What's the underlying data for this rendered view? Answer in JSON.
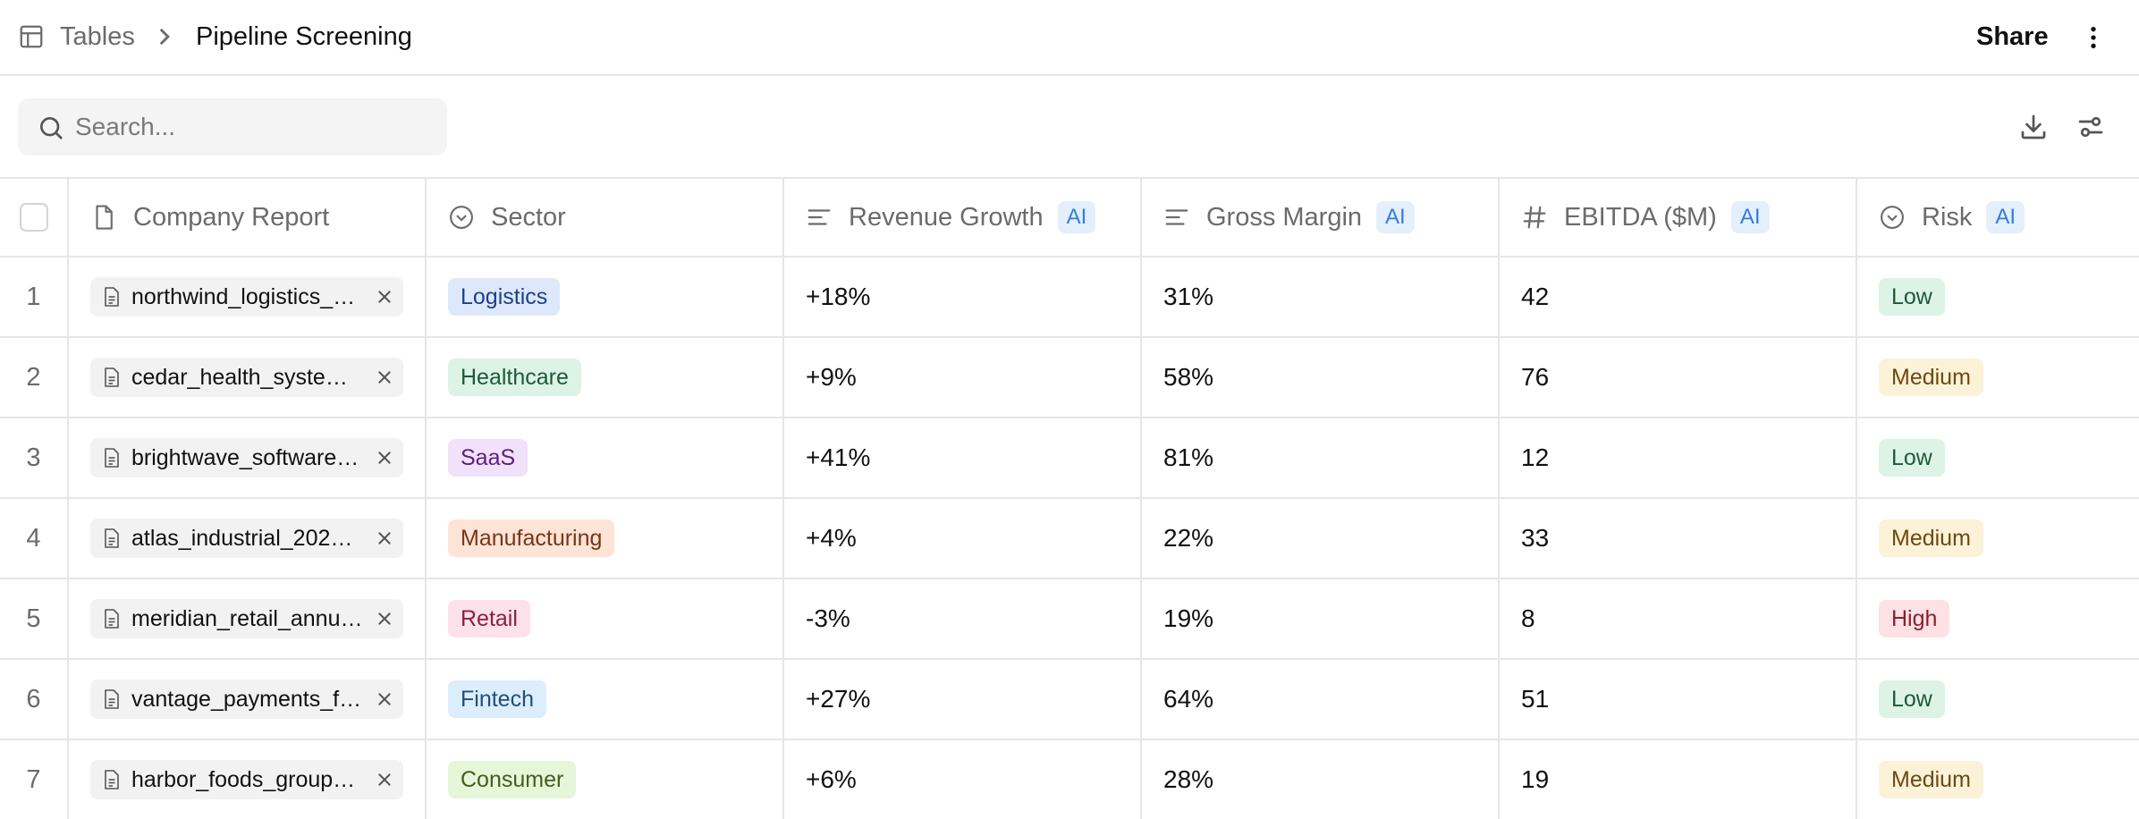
{
  "breadcrumb": {
    "root": "Tables",
    "current": "Pipeline Screening"
  },
  "header_actions": {
    "share_label": "Share"
  },
  "search": {
    "placeholder": "Search..."
  },
  "columns": {
    "company_report": "Company Report",
    "sector": "Sector",
    "revenue_growth": "Revenue Growth",
    "gross_margin": "Gross Margin",
    "ebitda": "EBITDA ($M)",
    "risk": "Risk",
    "ai_badge": "AI"
  },
  "sector_colors": {
    "Logistics": {
      "bg": "#dde9fb",
      "fg": "#1f3f8a"
    },
    "Healthcare": {
      "bg": "#dcf3e6",
      "fg": "#1d5a36"
    },
    "SaaS": {
      "bg": "#f1e1fb",
      "fg": "#5c1f7d"
    },
    "Manufacturing": {
      "bg": "#fde4d6",
      "fg": "#7a3414"
    },
    "Retail": {
      "bg": "#fde1ea",
      "fg": "#8a1f44"
    },
    "Fintech": {
      "bg": "#dcedfb",
      "fg": "#1f4f7d"
    },
    "Consumer": {
      "bg": "#e6f6d8",
      "fg": "#3f5f1d"
    }
  },
  "risk_colors": {
    "Low": {
      "bg": "#dcf3e6",
      "fg": "#1d5a36"
    },
    "Medium": {
      "bg": "#fcf2d8",
      "fg": "#6b4a12"
    },
    "High": {
      "bg": "#fde1e4",
      "fg": "#8a1f2c"
    }
  },
  "rows": [
    {
      "num": "1",
      "file": "northwind_logistics_…",
      "sector": "Logistics",
      "revenue_growth": "+18%",
      "gross_margin": "31%",
      "ebitda": "42",
      "risk": "Low"
    },
    {
      "num": "2",
      "file": "cedar_health_system…",
      "sector": "Healthcare",
      "revenue_growth": "+9%",
      "gross_margin": "58%",
      "ebitda": "76",
      "risk": "Medium"
    },
    {
      "num": "3",
      "file": "brightwave_software…",
      "sector": "SaaS",
      "revenue_growth": "+41%",
      "gross_margin": "81%",
      "ebitda": "12",
      "risk": "Low"
    },
    {
      "num": "4",
      "file": "atlas_industrial_202…",
      "sector": "Manufacturing",
      "revenue_growth": "+4%",
      "gross_margin": "22%",
      "ebitda": "33",
      "risk": "Medium"
    },
    {
      "num": "5",
      "file": "meridian_retail_annu…",
      "sector": "Retail",
      "revenue_growth": "-3%",
      "gross_margin": "19%",
      "ebitda": "8",
      "risk": "High"
    },
    {
      "num": "6",
      "file": "vantage_payments_f…",
      "sector": "Fintech",
      "revenue_growth": "+27%",
      "gross_margin": "64%",
      "ebitda": "51",
      "risk": "Low"
    },
    {
      "num": "7",
      "file": "harbor_foods_group…",
      "sector": "Consumer",
      "revenue_growth": "+6%",
      "gross_margin": "28%",
      "ebitda": "19",
      "risk": "Medium"
    }
  ]
}
